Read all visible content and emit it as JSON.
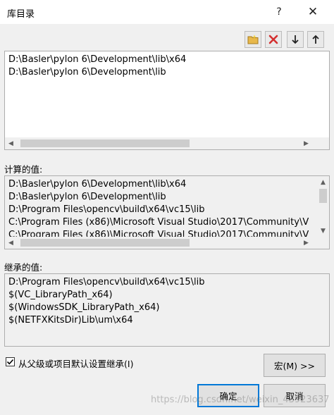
{
  "window": {
    "title": "库目录",
    "help_glyph": "?",
    "close_glyph": "✕"
  },
  "toolbar": {
    "new_line_icon": "folder-new-icon",
    "delete_icon": "delete-x-icon",
    "move_down_icon": "arrow-down-icon",
    "move_up_icon": "arrow-up-icon",
    "colors": {
      "folder": "#e8b84a",
      "delete": "#d32f2f",
      "arrow": "#222222"
    }
  },
  "editor": {
    "lines": [
      "D:\\Basler\\pylon 6\\Development\\lib\\x64",
      "D:\\Basler\\pylon 6\\Development\\lib"
    ]
  },
  "evaluated": {
    "label": "计算的值:",
    "lines": [
      "D:\\Basler\\pylon 6\\Development\\lib\\x64",
      "D:\\Basler\\pylon 6\\Development\\lib",
      "D:\\Program Files\\opencv\\build\\x64\\vc15\\lib",
      "C:\\Program Files (x86)\\Microsoft Visual Studio\\2017\\Community\\V",
      "C:\\Program Files (x86)\\Microsoft Visual Studio\\2017\\Community\\V"
    ]
  },
  "inherited": {
    "label": "继承的值:",
    "lines": [
      "D:\\Program Files\\opencv\\build\\x64\\vc15\\lib",
      "$(VC_LibraryPath_x64)",
      "$(WindowsSDK_LibraryPath_x64)",
      "$(NETFXKitsDir)Lib\\um\\x64"
    ]
  },
  "inherit_checkbox": {
    "label": "从父级或项目默认设置继承(I)",
    "checked": true
  },
  "buttons": {
    "macros": "宏(M) >>",
    "ok": "确定",
    "cancel": "取消"
  },
  "watermark": "https://blog.csdn.net/weixin_43923637"
}
